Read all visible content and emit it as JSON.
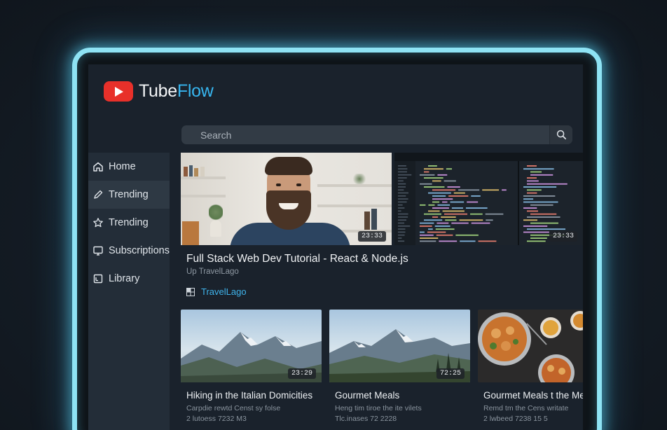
{
  "app": {
    "name_part1": "Tube",
    "name_part2": "Flow"
  },
  "search": {
    "placeholder": "Search"
  },
  "sidebar": {
    "items": [
      {
        "label": "Home",
        "icon": "home-icon"
      },
      {
        "label": "Trending",
        "icon": "pencil-icon",
        "active": true
      },
      {
        "label": "Trending",
        "icon": "star-icon"
      },
      {
        "label": "Subscriptions",
        "icon": "subscriptions-icon"
      },
      {
        "label": "Library",
        "icon": "library-icon"
      }
    ]
  },
  "featured": {
    "title": "Full Stack Web Dev Tutorial - React & Node.js",
    "subtitle": "Up TravelLago",
    "channel": "TravelLago",
    "duration_main": "23:33",
    "duration_code": "23:33"
  },
  "cards": [
    {
      "title": "Hiking in the Italian Domicities",
      "line1": "Carpdie rewtd Censt sy folse",
      "line2": "2 lutoess 7232 M3",
      "duration": "23:29"
    },
    {
      "title": "Gourmet Meals",
      "line1": "Heng tim tiroe the ite vilets",
      "line2": "Tlc.inases 72 2228",
      "duration": "72:25"
    },
    {
      "title": "Gourmet Meals t the Mel",
      "line1": "Remd tm the Cens writate",
      "line2": "2 lwbeed 7238 15 5",
      "duration": ""
    }
  ],
  "colors": {
    "accent": "#37b6f0",
    "logo_red": "#e8302a",
    "frame_glow": "#8ee3f4"
  }
}
